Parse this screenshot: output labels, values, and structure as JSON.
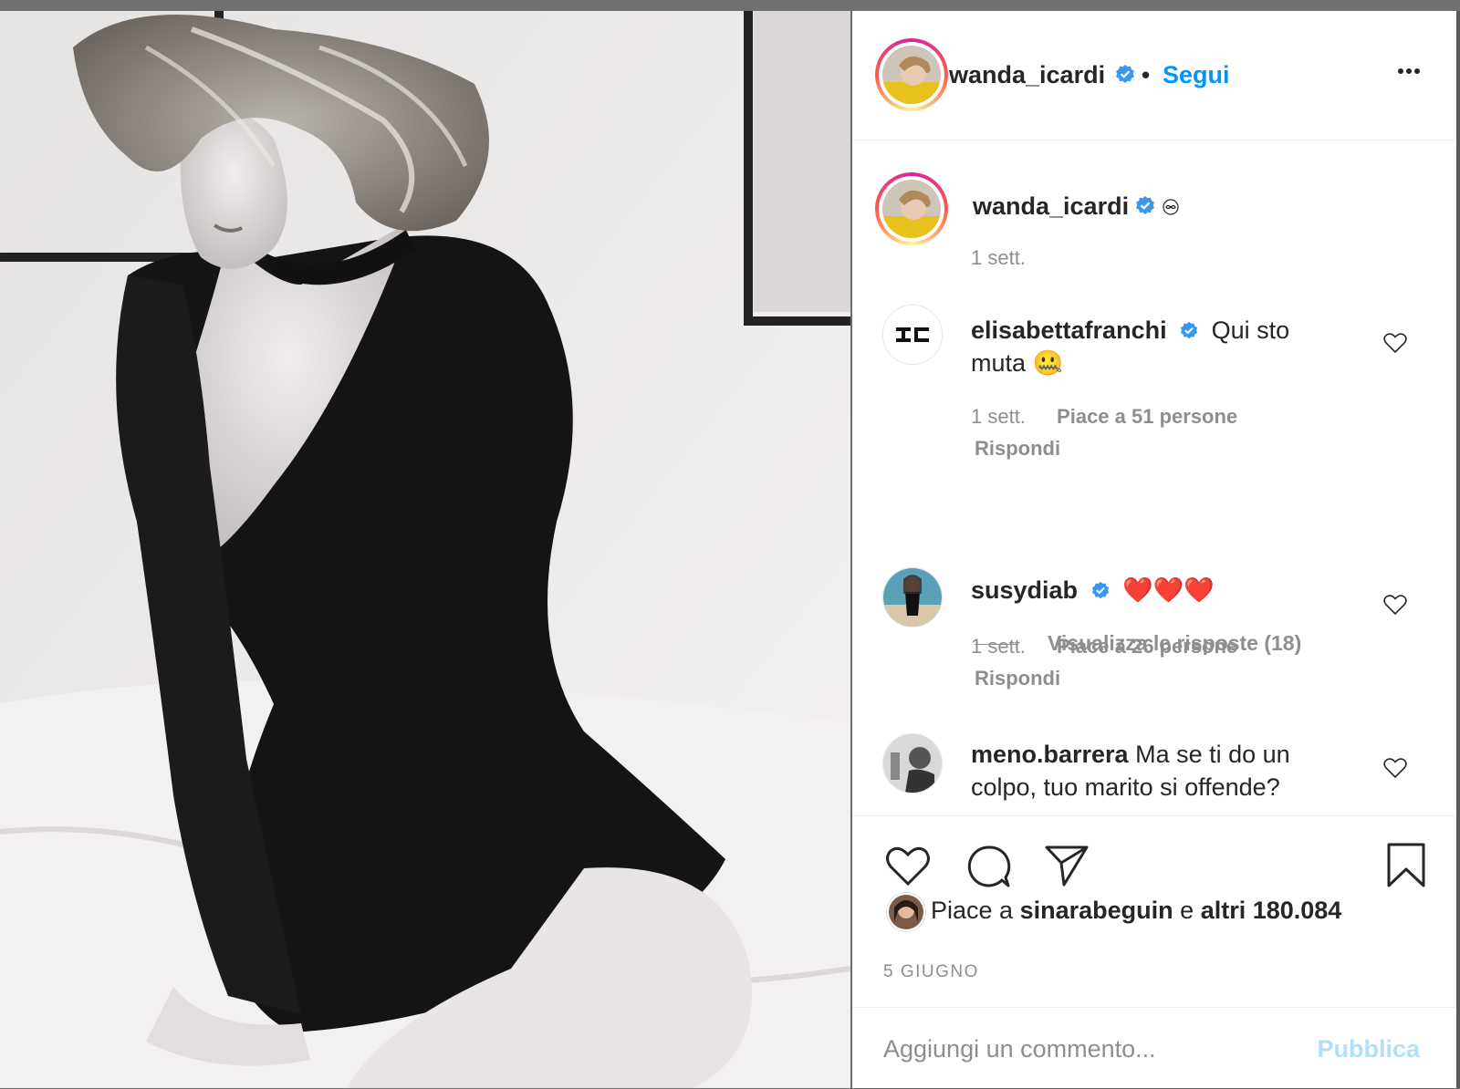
{
  "post": {
    "author": "wanda_icardi",
    "follow_label": "Segui",
    "separator": "•"
  },
  "caption": {
    "author": "wanda_icardi",
    "suffix_icon": "infinity-icon",
    "time": "1 sett."
  },
  "comments": [
    {
      "author": "elisabettafranchi",
      "verified": true,
      "text": "Qui sto muta 🤐",
      "time": "1 sett.",
      "likes": "Piace a 51 persone",
      "reply_label": "Rispondi",
      "view_replies": "Visualizza le risposte (18)"
    },
    {
      "author": "susydiab",
      "verified": true,
      "text": "❤️❤️❤️",
      "time": "1 sett.",
      "likes": "Piace a 26 persone",
      "reply_label": "Rispondi"
    },
    {
      "author": "meno.barrera",
      "verified": false,
      "text": "Ma se ti do un colpo, tuo marito si offende?"
    }
  ],
  "likes": {
    "prefix": "Piace a",
    "user": "sinarabeguin",
    "conj": "e",
    "others": "altri 180.084"
  },
  "date": "5 GIUGNO",
  "add_comment": {
    "placeholder": "Aggiungi un commento...",
    "post_label": "Pubblica"
  },
  "colors": {
    "accent": "#0095f6",
    "verified": "#3897f0",
    "muted": "#8e8e8e",
    "post_disabled": "#b2dffc"
  }
}
